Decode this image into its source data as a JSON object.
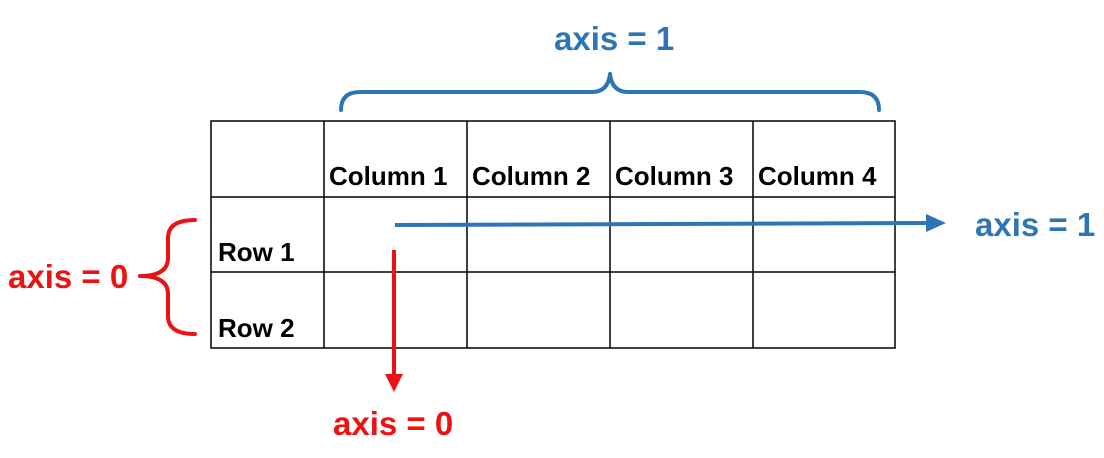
{
  "colors": {
    "axis1": "#2e75b6",
    "axis0": "#ee1111",
    "grid": "#000000",
    "text": "#000000"
  },
  "top_label": "axis = 1",
  "right_label": "axis = 1",
  "left_label": "axis = 0",
  "bottom_label": "axis = 0",
  "table": {
    "corner": "",
    "columns": [
      "Column 1",
      "Column 2",
      "Column 3",
      "Column 4"
    ],
    "rows": [
      {
        "label": "Row 1",
        "cells": [
          "",
          "",
          "",
          ""
        ]
      },
      {
        "label": "Row 2",
        "cells": [
          "",
          "",
          "",
          ""
        ]
      }
    ]
  }
}
